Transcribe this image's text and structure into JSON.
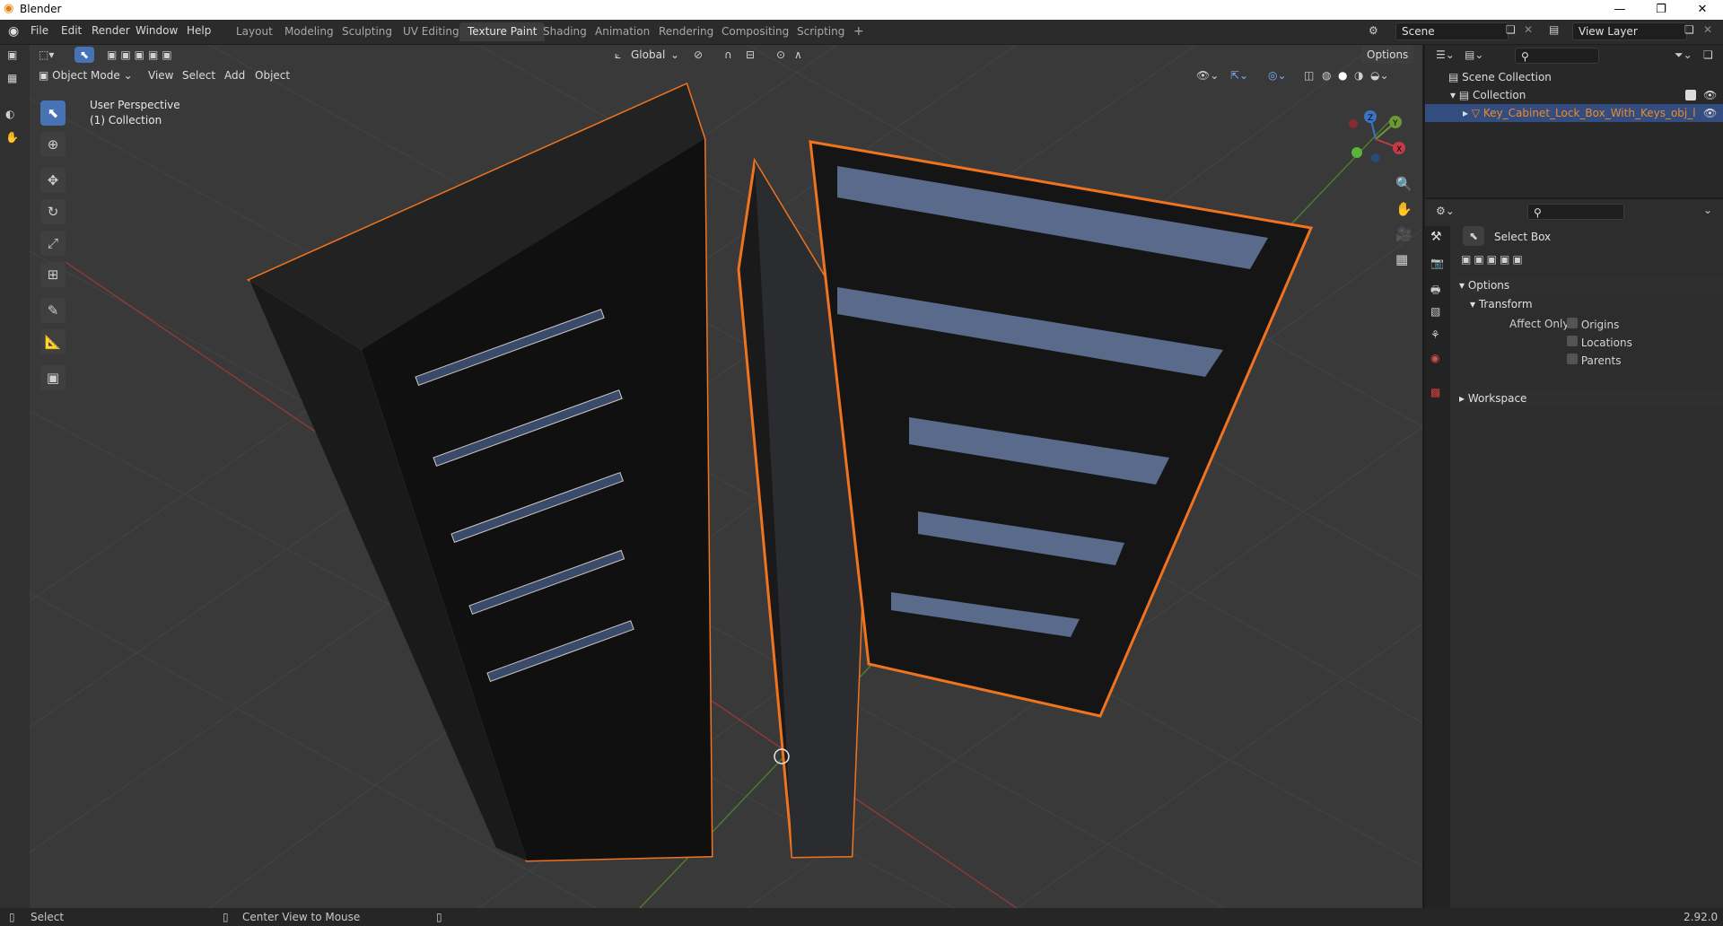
{
  "window": {
    "title": "Blender",
    "minimize": "—",
    "restore": "❐",
    "close": "✕"
  },
  "menu": [
    "File",
    "Edit",
    "Render",
    "Window",
    "Help"
  ],
  "workspaces": [
    "Layout",
    "Modeling",
    "Sculpting",
    "UV Editing",
    "Texture Paint",
    "Shading",
    "Animation",
    "Rendering",
    "Compositing",
    "Scripting"
  ],
  "add_workspace": "+",
  "scene": {
    "name": "Scene",
    "view_layer": "View Layer"
  },
  "viewport_header": {
    "mode": "Object Mode",
    "menus": [
      "View",
      "Select",
      "Add",
      "Object"
    ],
    "orientation": "Global",
    "options": "Options"
  },
  "viewport": {
    "perspective": "User Perspective",
    "collection": "(1) Collection"
  },
  "gizmo": {
    "x": "X",
    "y": "Y",
    "z": "Z"
  },
  "outliner": {
    "rows": [
      {
        "label": "Scene Collection"
      },
      {
        "label": "Collection"
      },
      {
        "label": "Key_Cabinet_Lock_Box_With_Keys_obj_l"
      }
    ]
  },
  "properties": {
    "tool_name": "Select Box",
    "options_label": "Options",
    "transform_label": "Transform",
    "affect_only_label": "Affect Only",
    "checkboxes": [
      "Origins",
      "Locations",
      "Parents"
    ],
    "workspace_label": "Workspace"
  },
  "status": {
    "left": "Select",
    "middle": "Center View to Mouse",
    "version": "2.92.0"
  },
  "colors": {
    "accent": "#4772b3",
    "selection": "#f08a24",
    "viewport_bg": "#393939"
  }
}
